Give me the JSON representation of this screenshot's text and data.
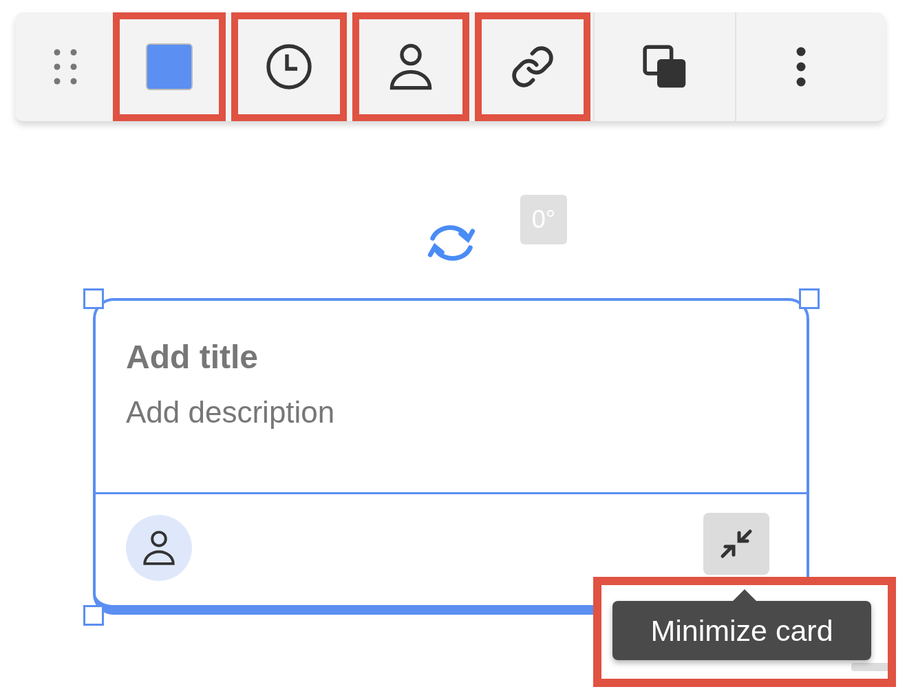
{
  "toolbar": {
    "items": [
      {
        "kind": "drag",
        "highlighted": false
      },
      {
        "kind": "color",
        "color": "#5b8ff2",
        "highlighted": true
      },
      {
        "kind": "clock",
        "highlighted": true
      },
      {
        "kind": "person",
        "highlighted": true
      },
      {
        "kind": "link",
        "highlighted": true
      },
      {
        "kind": "copy",
        "highlighted": false
      },
      {
        "kind": "more",
        "highlighted": false
      }
    ]
  },
  "rotation": {
    "angle": "0°"
  },
  "card": {
    "title_placeholder": "Add title",
    "description_placeholder": "Add description"
  },
  "tooltip": {
    "text": "Minimize card",
    "highlighted": true
  }
}
